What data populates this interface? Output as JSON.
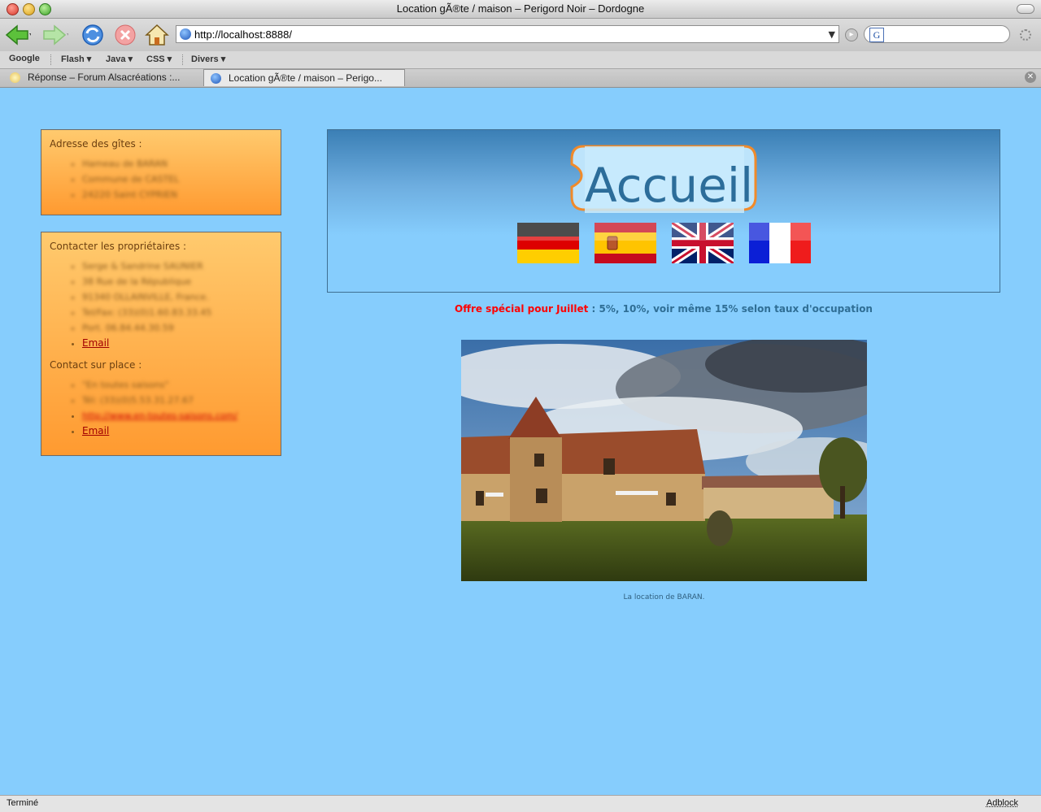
{
  "window": {
    "title": "Location gÃ®te / maison – Perigord Noir – Dordogne"
  },
  "toolbar": {
    "url": "http://localhost:8888/",
    "search_value": ""
  },
  "bookmarks": {
    "items": [
      "Google",
      "Flash ▾",
      "Java ▾",
      "CSS ▾",
      "Divers ▾"
    ]
  },
  "tabs": [
    {
      "label": "Réponse – Forum Alsacréations :...",
      "active": false
    },
    {
      "label": "Location gÃ®te / maison – Perigo...",
      "active": true
    }
  ],
  "sidebar": {
    "address_title": "Adresse des gîtes :",
    "address_lines": [
      "Hameau de BARAN",
      "Commune de CASTEL",
      "24220 Saint CYPRIEN"
    ],
    "owners_title": "Contacter les propriétaires :",
    "owners_lines": [
      "Serge & Sandrine SAUNIER",
      "38 Rue de la République",
      "91340 OLLAINVILLE, France.",
      "Tel/Fax: (33)(0)1.60.83.33.45",
      "Port. 06.84.44.30.59"
    ],
    "owners_email": "Email",
    "onsite_title": "Contact sur place :",
    "onsite_lines": [
      "\"En toutes saisons\"",
      "Tél: (33)(0)5.53.31.27.67"
    ],
    "onsite_link": "http://www.en-toutes-saisons.com/",
    "onsite_email": "Email"
  },
  "main": {
    "heading": "Accueil",
    "flags": [
      "german-flag",
      "spanish-flag",
      "uk-flag",
      "french-flag"
    ],
    "offer_label": "Offre spécial pour Juillet",
    "offer_text": " : 5%, 10%, voir même 15% selon taux d'occupation",
    "photo_caption": "La location de BARAN."
  },
  "status": {
    "text": "Terminé",
    "adblock": "Adblock"
  },
  "colors": {
    "page_bg": "#86cdfd",
    "sidebar_box_top": "#ffca6e",
    "sidebar_box_bottom": "#ff9a30",
    "heading_text": "#2c6d9a",
    "offer_red": "#ff0000"
  }
}
